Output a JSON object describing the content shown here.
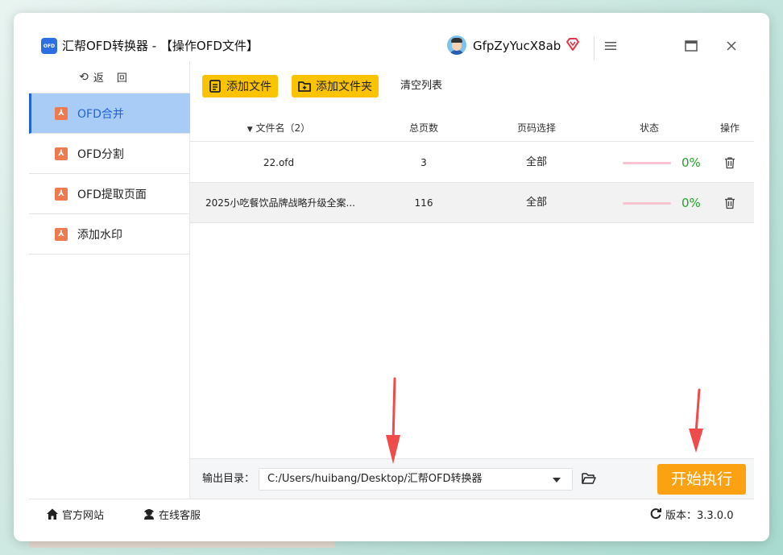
{
  "app": {
    "logo_text": "OFD",
    "title": "汇帮OFD转换器 - 【操作OFD文件】",
    "username": "GfpZyYucX8ab"
  },
  "sidebar": {
    "back_label": "返回",
    "items": [
      {
        "label": "OFD合并",
        "active": true
      },
      {
        "label": "OFD分割",
        "active": false
      },
      {
        "label": "OFD提取页面",
        "active": false
      },
      {
        "label": "添加水印",
        "active": false
      }
    ]
  },
  "toolbar": {
    "add_file": "添加文件",
    "add_folder": "添加文件夹",
    "clear_list": "清空列表"
  },
  "table": {
    "headers": {
      "filename": "文件名（2）",
      "pages": "总页数",
      "range": "页码选择",
      "status": "状态",
      "action": "操作"
    },
    "rows": [
      {
        "filename": "22.ofd",
        "pages": "3",
        "range": "全部",
        "progress": 0,
        "percent": "0%"
      },
      {
        "filename": "2025小吃餐饮品牌战略升级全案...",
        "pages": "116",
        "range": "全部",
        "progress": 0,
        "percent": "0%"
      }
    ]
  },
  "output": {
    "label": "输出目录：",
    "path": "C:/Users/huibang/Desktop/汇帮OFD转换器",
    "start_label": "开始执行"
  },
  "statusbar": {
    "website": "官方网站",
    "support": "在线客服",
    "version": "版本：3.3.0.0"
  },
  "colors": {
    "accent_yellow": "#fcc400",
    "start_orange": "#fca212",
    "active_bg": "#a9ccf7",
    "active_text": "#1f63d7",
    "percent_green": "#25a12a",
    "arrow_red": "#ef4b4b"
  },
  "icons": {
    "back": "undo-arrow-icon",
    "pdf": "pdf-file-icon",
    "add_file": "add-file-icon",
    "add_folder": "add-folder-icon",
    "sort": "sort-down-icon",
    "trash": "trash-icon",
    "folder": "folder-open-icon",
    "home": "home-icon",
    "support": "headset-icon",
    "refresh": "refresh-icon",
    "vip": "diamond-icon"
  }
}
